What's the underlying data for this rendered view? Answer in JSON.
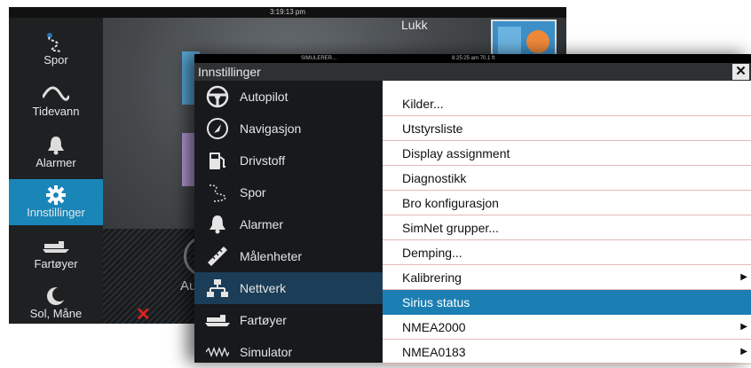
{
  "background": {
    "clock": "3:19:13 pm",
    "close_label": "Lukk",
    "sidebar_items": [
      {
        "label": "Spor",
        "icon": "track-icon",
        "selected": false
      },
      {
        "label": "Tidevann",
        "icon": "tide-icon",
        "selected": false
      },
      {
        "label": "Alarmer",
        "icon": "bell-icon",
        "selected": false
      },
      {
        "label": "Innstillinger",
        "icon": "gear-icon",
        "selected": true
      },
      {
        "label": "Fartøyer",
        "icon": "vessels-icon",
        "selected": false
      },
      {
        "label": "Sol, Måne",
        "icon": "sun-moon-icon",
        "selected": false
      }
    ],
    "partial_text": "Au"
  },
  "window": {
    "status_left": "SIMULERER...",
    "status_right": "8:25:25 am   70.1 ft",
    "title": "Innstillinger",
    "close_glyph": "✕",
    "categories": [
      {
        "label": "Autopilot",
        "icon": "steering-wheel-icon"
      },
      {
        "label": "Navigasjon",
        "icon": "compass-icon"
      },
      {
        "label": "Drivstoff",
        "icon": "fuel-pump-icon"
      },
      {
        "label": "Spor",
        "icon": "track-icon"
      },
      {
        "label": "Alarmer",
        "icon": "bell-icon"
      },
      {
        "label": "Målenheter",
        "icon": "ruler-icon"
      },
      {
        "label": "Nettverk",
        "icon": "network-icon",
        "selected": true
      },
      {
        "label": "Fartøyer",
        "icon": "vessels-icon"
      },
      {
        "label": "Simulator",
        "icon": "simulator-icon"
      }
    ],
    "options": [
      {
        "label": "Kilder..."
      },
      {
        "label": "Utstyrsliste"
      },
      {
        "label": "Display assignment"
      },
      {
        "label": "Diagnostikk"
      },
      {
        "label": "Bro konfigurasjon"
      },
      {
        "label": "SimNet grupper..."
      },
      {
        "label": "Demping..."
      },
      {
        "label": "Kalibrering",
        "submenu": true
      },
      {
        "label": "Sirius status",
        "selected": true
      },
      {
        "label": "NMEA2000",
        "submenu": true
      },
      {
        "label": "NMEA0183",
        "submenu": true
      }
    ],
    "submenu_arrow": "▶"
  },
  "colors": {
    "accent": "#1c7fb3",
    "selected_category": "#1b3d57",
    "error_mark": "#e02020"
  }
}
